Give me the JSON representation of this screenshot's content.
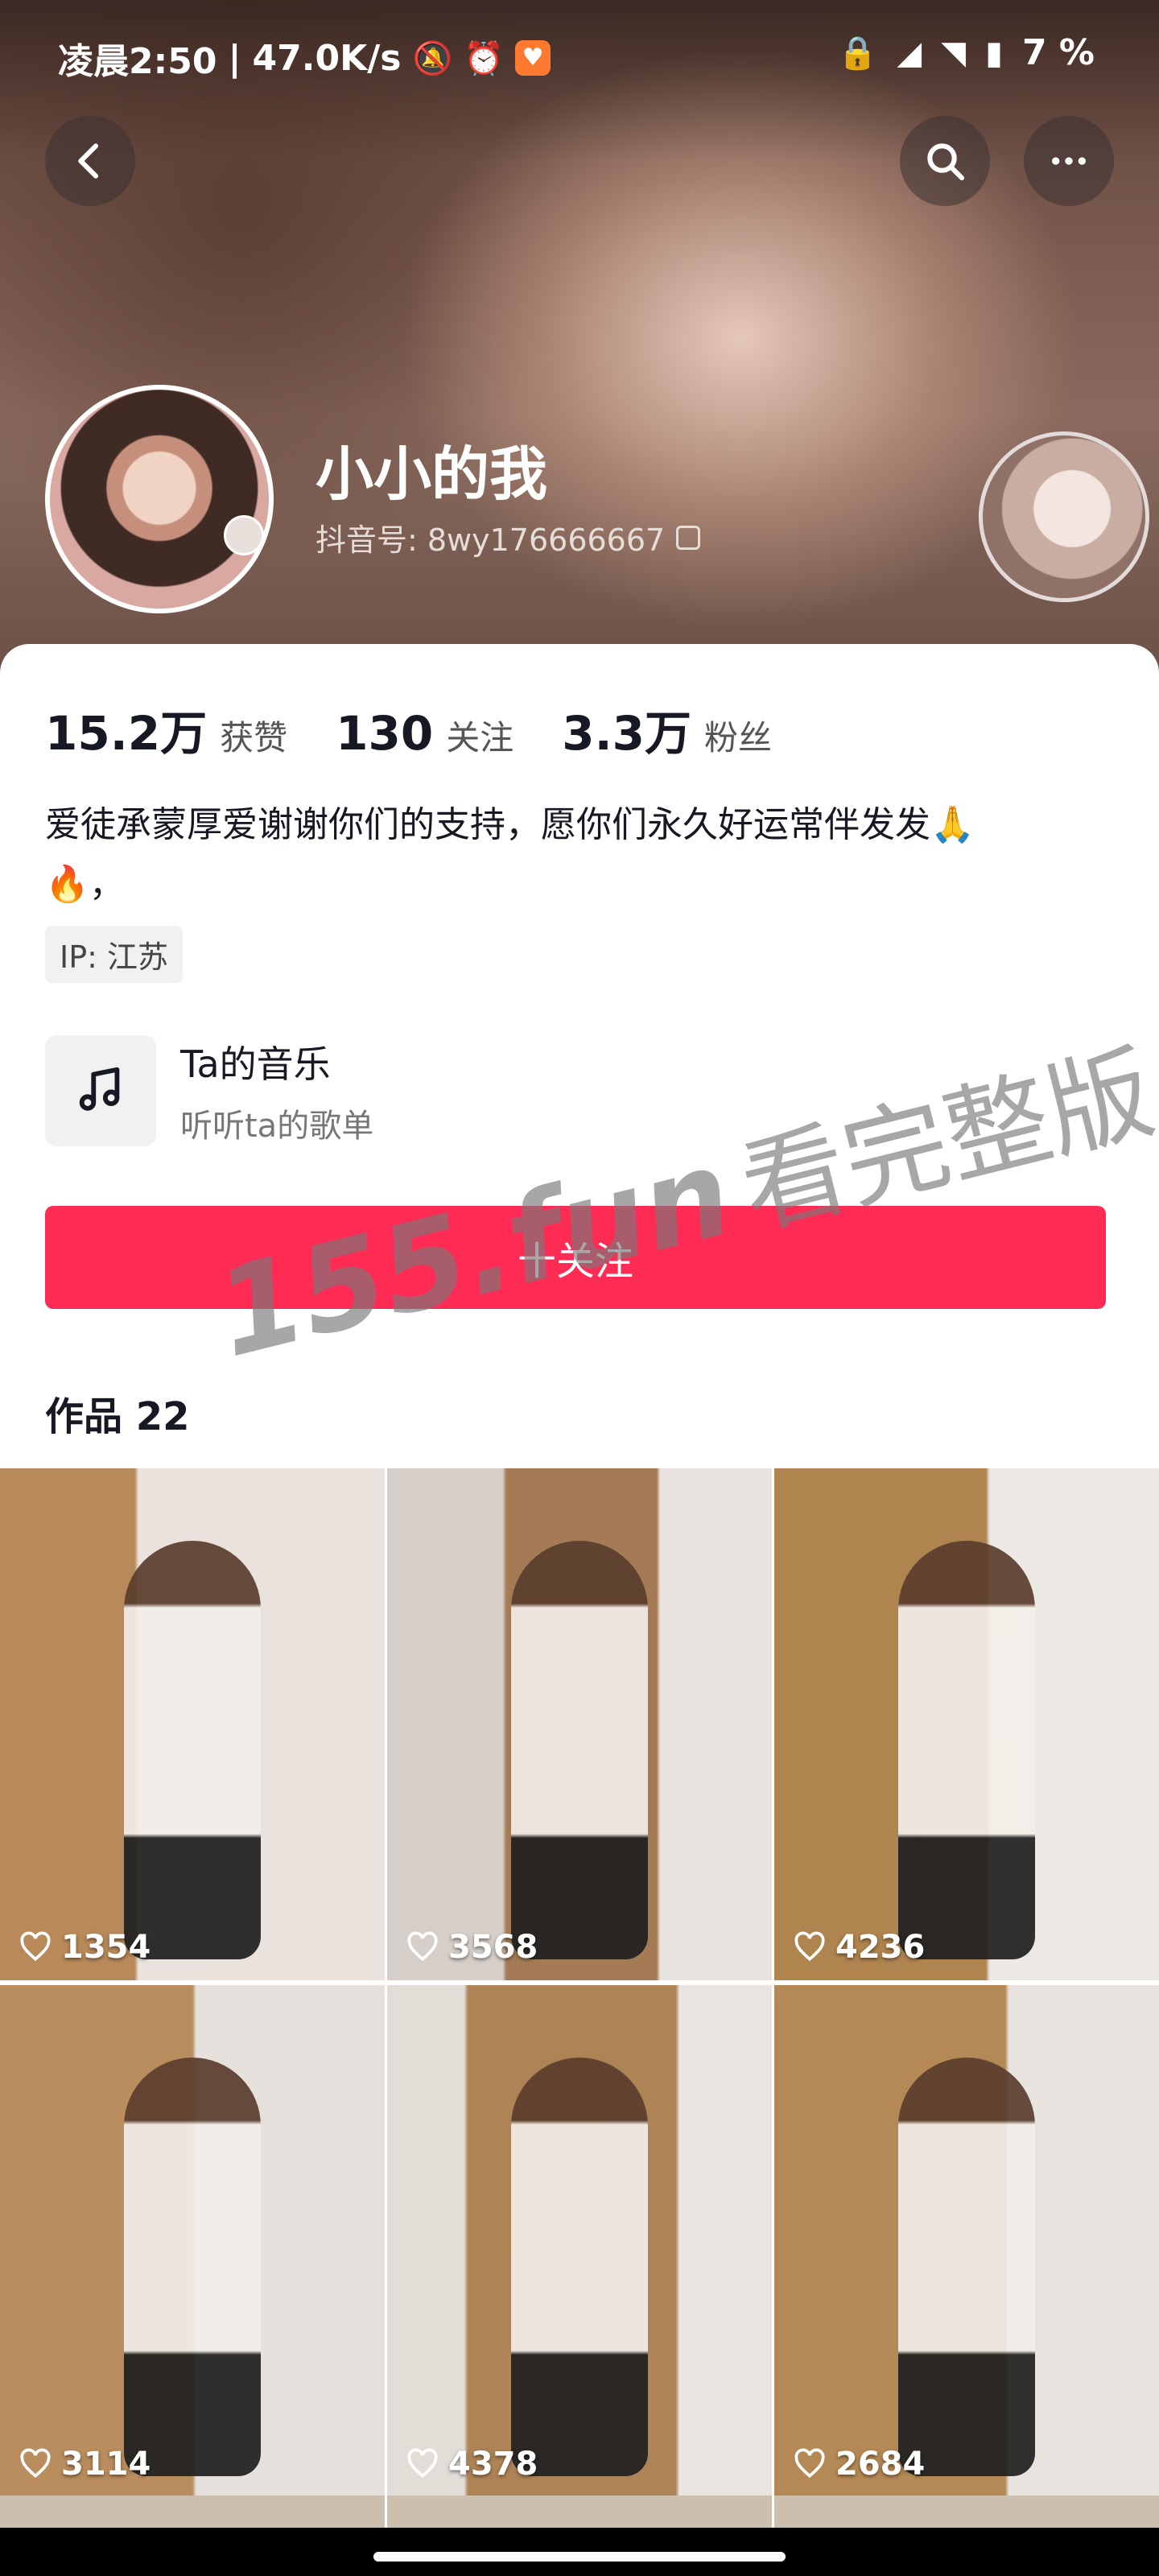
{
  "status_bar": {
    "time": "凌晨2:50",
    "net_speed": "47.0K/s",
    "battery": "7 %"
  },
  "profile": {
    "name": "小小的我",
    "douyin_id": "抖音号: 8wy176666667",
    "stats": [
      {
        "value": "15.2万",
        "label": "获赞"
      },
      {
        "value": "130",
        "label": "关注"
      },
      {
        "value": "3.3万",
        "label": "粉丝"
      }
    ],
    "bio_line1": "爱徒承蒙厚爱谢谢你们的支持，愿你们永久好运常伴发发🙏",
    "bio_line2": "🔥，",
    "ip": "IP: 江苏"
  },
  "music": {
    "title": "Ta的音乐",
    "subtitle": "听听ta的歌单"
  },
  "follow_button": "十关注",
  "works_label": "作品 22",
  "watermark": {
    "site": "155.fun",
    "text": "看完整版"
  },
  "videos": [
    {
      "likes": "1354"
    },
    {
      "likes": "3568"
    },
    {
      "likes": "4236"
    },
    {
      "likes": "3114"
    },
    {
      "likes": "4378"
    },
    {
      "likes": "2684"
    }
  ],
  "icons": [
    "back-icon",
    "search-icon",
    "more-icon",
    "music-note-icon",
    "heart-icon",
    "copy-icon"
  ],
  "colors": {
    "accent": "#fe2c55",
    "text": "#161823"
  }
}
